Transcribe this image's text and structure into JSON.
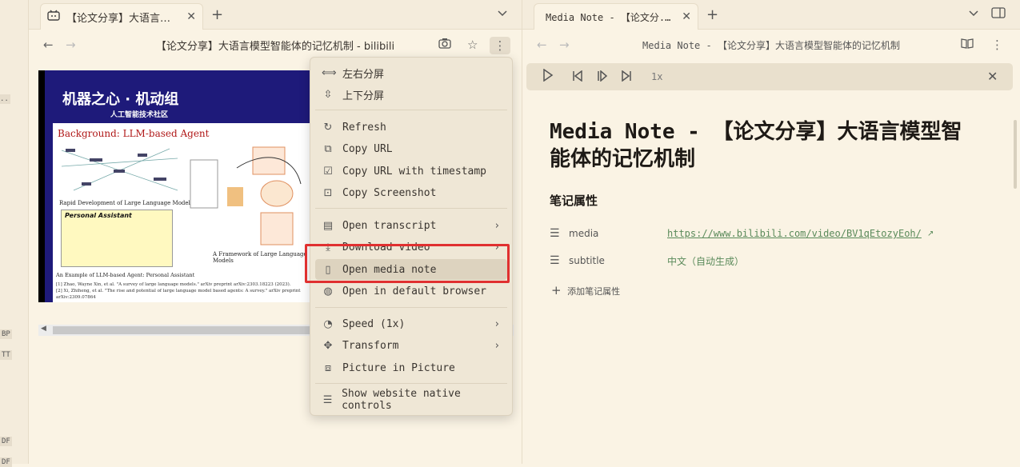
{
  "left_strip": {
    "labels": [
      "BP",
      "TT",
      "DF",
      "DF"
    ]
  },
  "left_tab": {
    "icon": "bilibili-tv-icon",
    "title": "【论文分享】大语言模...",
    "close": "✕"
  },
  "left_nav": {
    "title": "【论文分享】大语言模型智能体的记忆机制 - bilibili"
  },
  "video": {
    "logo_main": "机器之心 · 机动组",
    "logo_sub": "人工智能技术社区",
    "slide_title": "Background: LLM-based Agent",
    "slide_sub": "Rapid Development of Large Language Models [1]",
    "slide_pa": "Personal Assistant",
    "slide_fw": "A Framework of Large Language Models",
    "slide_ex": "An Example of LLM-based Agent: Personal Assistant",
    "slide_refs": [
      "[1] Zhao, Wayne Xin, et al. \"A survey of large language models.\" arXiv preprint arXiv:2303.18223 (2023).",
      "[2] Xi, Zhiheng, et al. \"The rise and potential of large language model based agents: A survey.\" arXiv preprint arXiv:2309.07864"
    ]
  },
  "menu": {
    "items": [
      {
        "icon": "split-horizontal-icon",
        "label": "左右分屏"
      },
      {
        "icon": "split-vertical-icon",
        "label": "上下分屏"
      },
      {
        "icon": "refresh-icon",
        "label": "Refresh"
      },
      {
        "icon": "copy-icon",
        "label": "Copy URL"
      },
      {
        "icon": "copy-check-icon",
        "label": "Copy URL with timestamp"
      },
      {
        "icon": "screenshot-icon",
        "label": "Copy Screenshot"
      },
      {
        "icon": "transcript-icon",
        "label": "Open transcript"
      },
      {
        "icon": "download-icon",
        "label": "Download video"
      },
      {
        "icon": "book-icon",
        "label": "Open media note"
      },
      {
        "icon": "globe-icon",
        "label": "Open in default browser"
      },
      {
        "icon": "speed-icon",
        "label": "Speed (1x)"
      },
      {
        "icon": "transform-icon",
        "label": "Transform"
      },
      {
        "icon": "picture-in-picture-icon",
        "label": "Picture in Picture"
      },
      {
        "icon": "sliders-icon",
        "label": "Show website native controls"
      }
    ]
  },
  "right_tab": {
    "title": "Media Note - 【论文分...",
    "close": "✕"
  },
  "right_nav": {
    "title": "Media Note - 【论文分享】大语言模型智能体的记忆机制"
  },
  "player": {
    "speed": "1x"
  },
  "note": {
    "title": "Media Note - 【论文分享】大语言模型智能体的记忆机制",
    "props_heading": "笔记属性",
    "media_name": "media",
    "media_value": "https://www.bilibili.com/video/BV1qEtozyEoh/",
    "subtitle_name": "subtitle",
    "subtitle_value": "中文（自动生成）",
    "add_prop": "添加笔记属性"
  }
}
